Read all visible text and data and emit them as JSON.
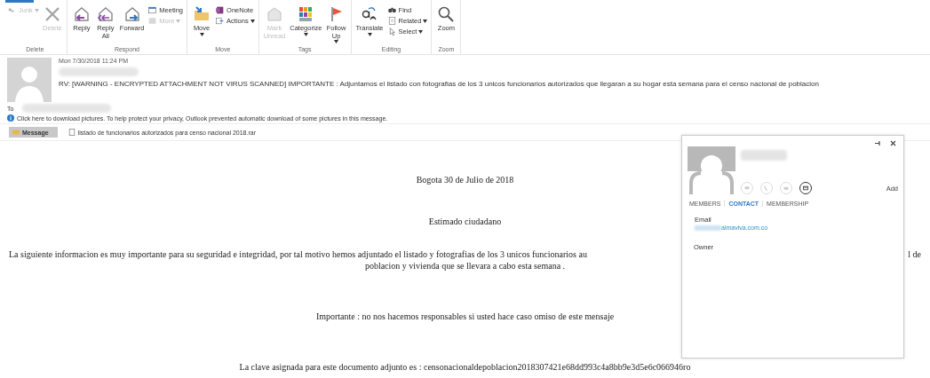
{
  "ribbon": {
    "groups": [
      {
        "label": "Delete",
        "items": [
          {
            "kind": "small",
            "label": "Junk",
            "dropdown": true,
            "disabled": true
          },
          {
            "kind": "large",
            "label": "Delete",
            "dropdown": false,
            "disabled": true
          }
        ]
      },
      {
        "label": "Respond",
        "items": [
          {
            "kind": "large",
            "label": "Reply",
            "dropdown": false,
            "disabled": false
          },
          {
            "kind": "large",
            "label": "Reply All",
            "dropdown": false,
            "disabled": false
          },
          {
            "kind": "large",
            "label": "Forward",
            "dropdown": false,
            "disabled": false
          },
          {
            "kind": "small",
            "label": "Meeting",
            "dropdown": false,
            "disabled": false
          },
          {
            "kind": "small",
            "label": "More",
            "dropdown": true,
            "disabled": true
          }
        ]
      },
      {
        "label": "Move",
        "items": [
          {
            "kind": "large",
            "label": "Move",
            "dropdown": true,
            "disabled": false
          },
          {
            "kind": "small",
            "label": "OneNote",
            "dropdown": false,
            "disabled": false
          },
          {
            "kind": "small",
            "label": "Actions",
            "dropdown": true,
            "disabled": false
          }
        ]
      },
      {
        "label": "Tags",
        "items": [
          {
            "kind": "large",
            "label": "Mark Unread",
            "dropdown": false,
            "disabled": true
          },
          {
            "kind": "large",
            "label": "Categorize",
            "dropdown": true,
            "disabled": false
          },
          {
            "kind": "large",
            "label": "Follow Up",
            "dropdown": true,
            "disabled": false
          }
        ]
      },
      {
        "label": "Editing",
        "items": [
          {
            "kind": "large",
            "label": "Translate",
            "dropdown": true,
            "disabled": false
          },
          {
            "kind": "small",
            "label": "Find",
            "dropdown": false,
            "disabled": false
          },
          {
            "kind": "small",
            "label": "Related",
            "dropdown": true,
            "disabled": false
          },
          {
            "kind": "small",
            "label": "Select",
            "dropdown": true,
            "disabled": false
          }
        ]
      },
      {
        "label": "Zoom",
        "items": [
          {
            "kind": "large",
            "label": "Zoom",
            "dropdown": false,
            "disabled": false
          }
        ]
      }
    ]
  },
  "header": {
    "date": "Mon 7/30/2018 11:24 PM",
    "subject": "RV: [WARNING - ENCRYPTED ATTACHMENT NOT VIRUS SCANNED]  IMPORTANTE : Adjuntamos el listado con fotografias de los 3 unicos funcionarios autorizados que llegaran a su hogar esta semana para el censo nacional de poblacion",
    "to_label": "To",
    "info": "Click here to download pictures. To help protect your privacy, Outlook prevented automatic download of some pictures in this message."
  },
  "attachments": [
    {
      "label": "Message",
      "kind": "message",
      "selected": true
    },
    {
      "label": "listado de funcionarios autorizados para censo nacional 2018.rar",
      "kind": "file",
      "selected": false
    }
  ],
  "body": {
    "date_line": "Bogota 30 de Julio de 2018",
    "greeting": "Estimado ciudadano",
    "paragraph_left": "La siguiente informacion es muy importante para su seguridad e integridad, por tal motivo hemos adjuntado el listado y fotografias de los 3 unicos funcionarios au",
    "paragraph_right": "l de",
    "paragraph_line2": "poblacion y vivienda que se llevara a cabo esta semana .",
    "warning": "Importante : no nos hacemos responsables si usted hace caso omiso de este mensaje",
    "key_line": "La clave asignada para este documento adjunto es :  censonacionaldepoblacion2018307421e68dd993c4a8bb9e3d5e6c066946ro"
  },
  "contact_card": {
    "actions": [
      {
        "disabled": true
      },
      {
        "disabled": true
      },
      {
        "disabled": true
      },
      {
        "disabled": false
      }
    ],
    "add": "Add",
    "tabs": [
      {
        "label": "MEMBERS",
        "selected": false
      },
      {
        "label": "CONTACT",
        "selected": true
      },
      {
        "label": "MEMBERSHIP",
        "selected": false
      }
    ],
    "email_label": "Email",
    "email_value": "almaviva.com.co",
    "owner_label": "Owner"
  }
}
